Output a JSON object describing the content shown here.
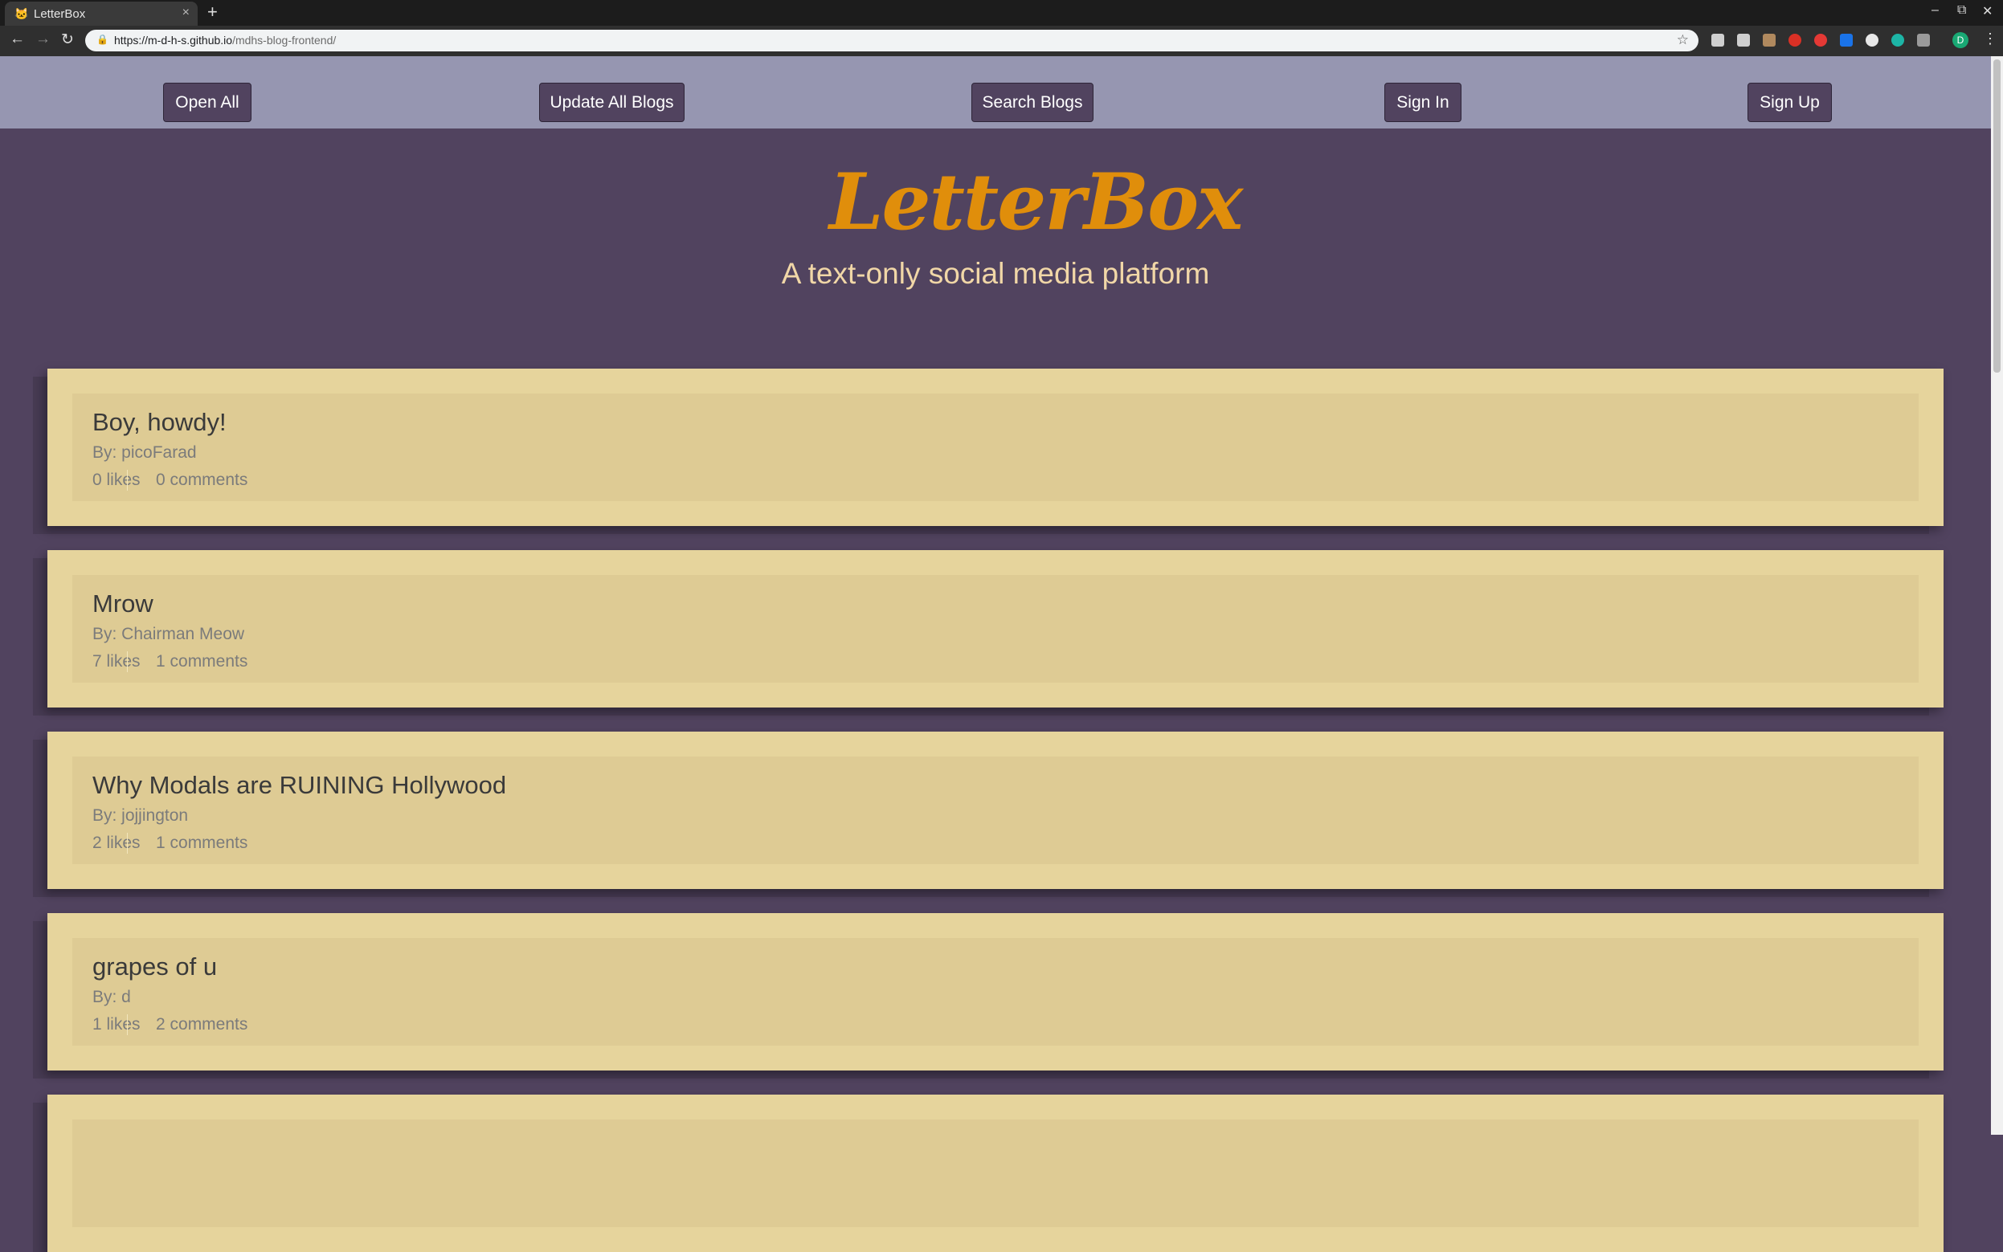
{
  "browser": {
    "tab_title": "LetterBox",
    "tab_favicon": "cat-face-icon",
    "url_host": "https://m-d-h-s.github.io",
    "url_path": "/mdhs-blog-frontend/",
    "profile_initial": "D"
  },
  "nav": {
    "open_all": "Open All",
    "update_all": "Update All Blogs",
    "search": "Search Blogs",
    "sign_in": "Sign In",
    "sign_up": "Sign Up"
  },
  "header": {
    "logo_text": "LetterBox",
    "tagline": "A text-only social media platform"
  },
  "posts": [
    {
      "title": "Boy, howdy!",
      "author": "By: picoFarad",
      "likes": "0 likes",
      "comments": "0 comments"
    },
    {
      "title": "Mrow",
      "author": "By: Chairman Meow",
      "likes": "7 likes",
      "comments": "1 comments"
    },
    {
      "title": "Why Modals are RUINING Hollywood",
      "author": "By: jojjington",
      "likes": "2 likes",
      "comments": "1 comments"
    },
    {
      "title": "grapes of u",
      "author": "By: d",
      "likes": "1 likes",
      "comments": "2 comments"
    },
    {
      "title": "",
      "author": "",
      "likes": "",
      "comments": ""
    }
  ],
  "colors": {
    "page_background": "#51435f",
    "navbar_background": "#9696b1",
    "button_background": "#51435f",
    "logo": "#e08e0b",
    "tagline": "#f1d7a7",
    "card_outer": "#e6d49c",
    "card_inner": "#decb94"
  }
}
